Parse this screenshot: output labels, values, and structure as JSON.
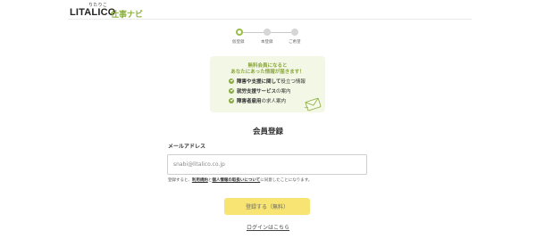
{
  "header": {
    "logo_ruby": "りたりこ",
    "logo_text": "LITALICO",
    "logo_sub": "仕事ナビ"
  },
  "steps": [
    {
      "label": "仮登録",
      "active": true
    },
    {
      "label": "本登録",
      "active": false
    },
    {
      "label": "ご希望",
      "active": false
    }
  ],
  "promo": {
    "headline_1": "無料会員になると",
    "headline_2": "あなたにあった情報が届きます！",
    "items": [
      {
        "bold": "障害や支援に関して",
        "rest": "役立つ情報"
      },
      {
        "bold": "就労支援サービス",
        "rest": "の案内"
      },
      {
        "bold": "障害者雇用",
        "rest": "の求人案内"
      }
    ],
    "icon": "envelope-icon"
  },
  "form": {
    "title": "会員登録",
    "email_label": "メールアドレス",
    "email_placeholder": "snabi@litalico.co.jp",
    "terms_prefix": "登録すると、",
    "terms_link_1": "利用規約",
    "terms_mid": "と",
    "terms_link_2": "個人情報の取扱いについて",
    "terms_suffix": "に同意したことになります。",
    "submit_label": "登録する（無料）",
    "login_link": "ログインはこちら"
  },
  "colors": {
    "brand_green": "#8cb43c",
    "promo_bg": "#f3f7e6",
    "button_yellow": "#f8e472"
  }
}
